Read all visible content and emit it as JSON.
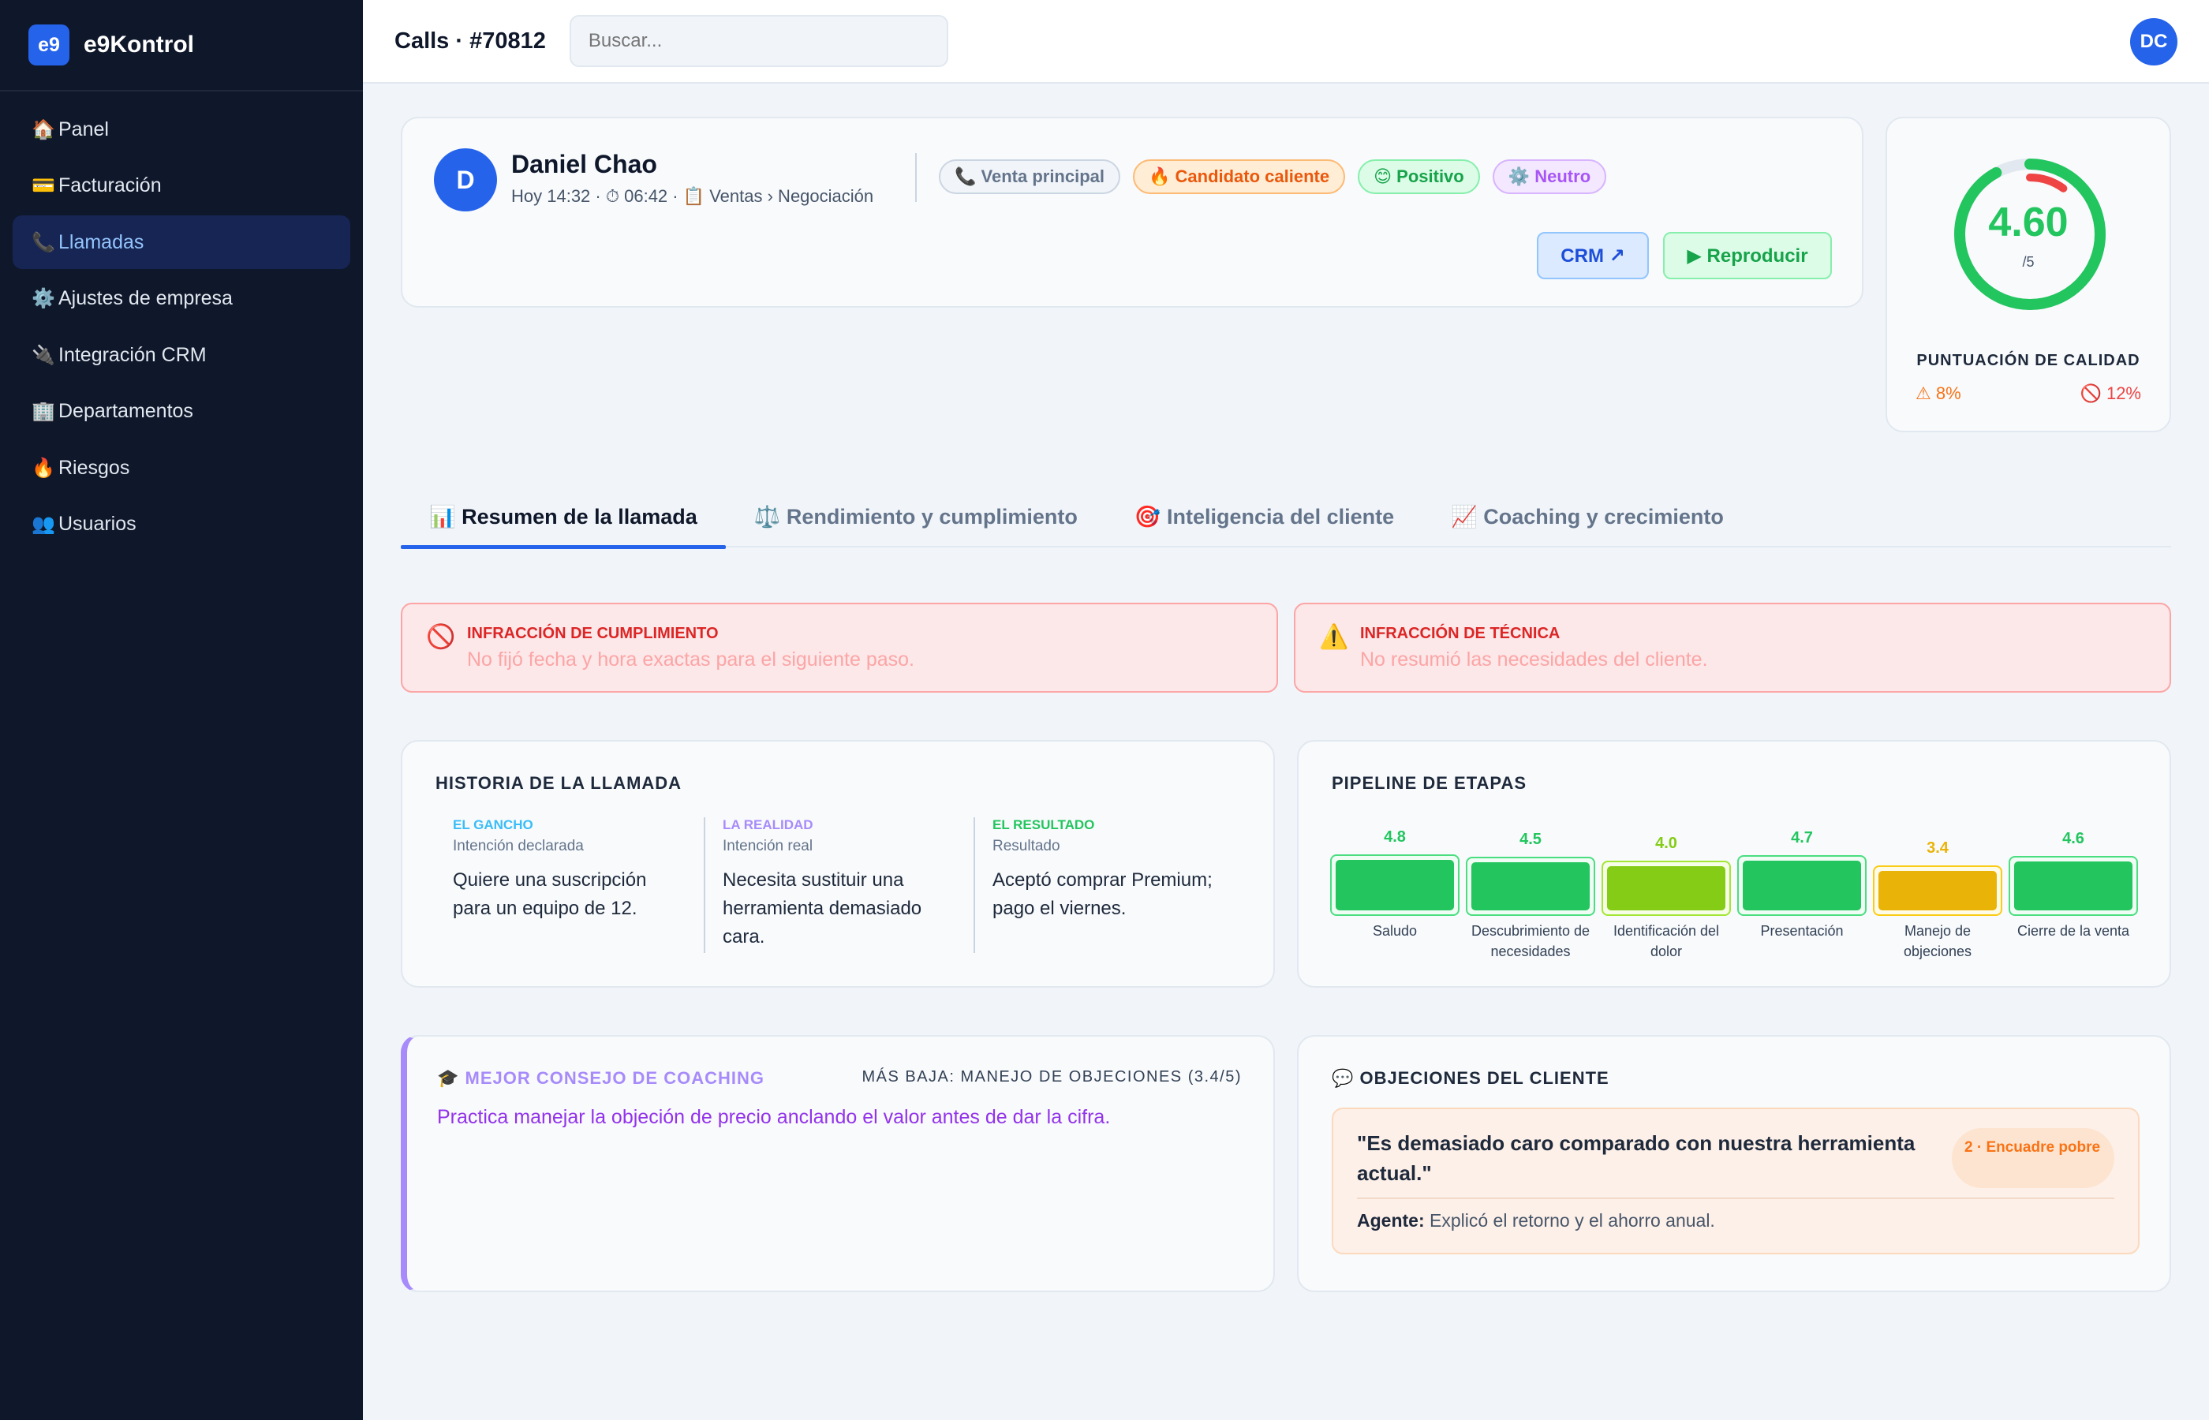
{
  "app": {
    "logo": "e9",
    "name": "e9Kontrol"
  },
  "sidebar": {
    "items": [
      {
        "icon": "🏠",
        "label": "Panel"
      },
      {
        "icon": "💳",
        "label": "Facturación"
      },
      {
        "icon": "📞",
        "label": "Llamadas",
        "active": true
      },
      {
        "icon": "⚙️",
        "label": "Ajustes de empresa"
      },
      {
        "icon": "🔌",
        "label": "Integración CRM"
      },
      {
        "icon": "🏢",
        "label": "Departamentos"
      },
      {
        "icon": "🔥",
        "label": "Riesgos"
      },
      {
        "icon": "👥",
        "label": "Usuarios"
      }
    ]
  },
  "topbar": {
    "title": "Calls · #70812",
    "search_placeholder": "Buscar...",
    "user_initials": "DC"
  },
  "call": {
    "initial": "D",
    "name": "Daniel Chao",
    "meta": "Hoy 14:32 · ⏱ 06:42 · 📋 Ventas › Negociación",
    "chips": [
      {
        "label": "📞 Venta principal",
        "style": "gray"
      },
      {
        "label": "🔥 Candidato caliente",
        "style": "orange"
      },
      {
        "label": "😊 Positivo",
        "style": "green"
      },
      {
        "label": "⚙️ Neutro",
        "style": "purple"
      }
    ],
    "crm_label": "CRM ↗",
    "play_label": "▶ Reproducir"
  },
  "quality": {
    "score": "4.60",
    "max": "/5",
    "score_fraction": 0.92,
    "label": "PUNTUACIÓN DE CALIDAD",
    "warn": "⚠ 8%",
    "ban": "🚫 12%",
    "colors": {
      "good": "#22c55e",
      "bad": "#ef4444",
      "track": "#e2e8f0"
    }
  },
  "tabs": [
    {
      "label": "📊 Resumen de la llamada",
      "active": true
    },
    {
      "label": "⚖️ Rendimiento y cumplimiento"
    },
    {
      "label": "🎯 Inteligencia del cliente"
    },
    {
      "label": "📈 Coaching y crecimiento"
    }
  ],
  "alerts": [
    {
      "icon": "🚫",
      "title": "INFRACCIÓN DE CUMPLIMIENTO",
      "text": "No fijó fecha y hora exactas para el siguiente paso."
    },
    {
      "icon": "⚠️",
      "title": "INFRACCIÓN DE TÉCNICA",
      "text": "No resumió las necesidades del cliente."
    }
  ],
  "story": {
    "title": "HISTORIA DE LA LLAMADA",
    "columns": [
      {
        "kicker": "EL GANCHO",
        "color": "#38bdf8",
        "sub": "Intención declarada",
        "body": "Quiere una suscripción para un equipo de 12."
      },
      {
        "kicker": "LA REALIDAD",
        "color": "#a78bfa",
        "sub": "Intención real",
        "body": "Necesita sustituir una herramienta demasiado cara."
      },
      {
        "kicker": "EL RESULTADO",
        "color": "#22c55e",
        "sub": "Resultado",
        "body": "Aceptó comprar Premium; pago el viernes."
      }
    ]
  },
  "pipeline": {
    "title": "PIPELINE DE ETAPAS",
    "stages": [
      {
        "score": "4.8",
        "value": 4.8,
        "label": "Saludo",
        "color": "#22c55e",
        "border": "#4ade80",
        "bg": "#f0fdf4"
      },
      {
        "score": "4.5",
        "value": 4.5,
        "label": "Descubrimiento de necesidades",
        "color": "#22c55e",
        "border": "#4ade80",
        "bg": "#f0fdf4"
      },
      {
        "score": "4.0",
        "value": 4.0,
        "label": "Identificación del dolor",
        "color": "#84cc16",
        "border": "#a3e635",
        "bg": "#f7fee7"
      },
      {
        "score": "4.7",
        "value": 4.7,
        "label": "Presentación",
        "color": "#22c55e",
        "border": "#4ade80",
        "bg": "#f0fdf4"
      },
      {
        "score": "3.4",
        "value": 3.4,
        "label": "Manejo de objeciones",
        "color": "#eab308",
        "border": "#facc15",
        "bg": "#fefce8"
      },
      {
        "score": "4.6",
        "value": 4.6,
        "label": "Cierre de la venta",
        "color": "#22c55e",
        "border": "#4ade80",
        "bg": "#f0fdf4"
      }
    ]
  },
  "coaching": {
    "title": "🎓 MEJOR CONSEJO DE COACHING",
    "lowest": "MÁS BAJA: MANEJO DE OBJECIONES (3.4/5)",
    "text": "Practica manejar la objeción de precio anclando el valor antes de dar la cifra."
  },
  "objections": {
    "title": "💬 OBJECIONES DEL CLIENTE",
    "items": [
      {
        "quote": "\"Es demasiado caro comparado con nuestra herramienta actual.\"",
        "badge": "2 · Encuadre pobre",
        "agent_label": "Agente:",
        "agent_text": " Explicó el retorno y el ahorro anual."
      }
    ]
  }
}
